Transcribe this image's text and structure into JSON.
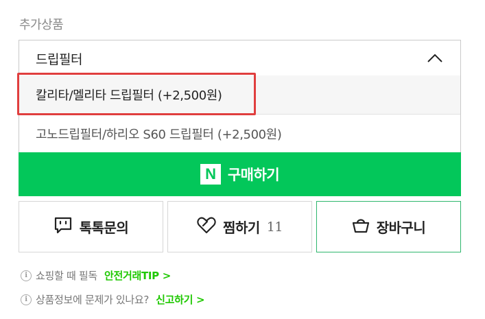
{
  "section": {
    "title": "추가상품"
  },
  "dropdown": {
    "selected_label": "드립필터",
    "options": [
      "칼리타/멜리타 드립필터 (+2,500원)",
      "고노드립필터/하리오 S60 드립필터 (+2,500원)"
    ]
  },
  "buy": {
    "logo": "N",
    "label": "구매하기"
  },
  "actions": {
    "inquiry_label": "톡톡문의",
    "wish_label": "찜하기",
    "wish_count": "11",
    "cart_label": "장바구니"
  },
  "info": {
    "line1_text": "쇼핑할 때 필독",
    "line1_link": "안전거래TIP >",
    "line2_text": "상품정보에 문제가 있나요?",
    "line2_link": "신고하기 >"
  },
  "colors": {
    "brand_green": "#03c75a",
    "link_green": "#1ec800",
    "highlight_red": "#e03e3e"
  }
}
